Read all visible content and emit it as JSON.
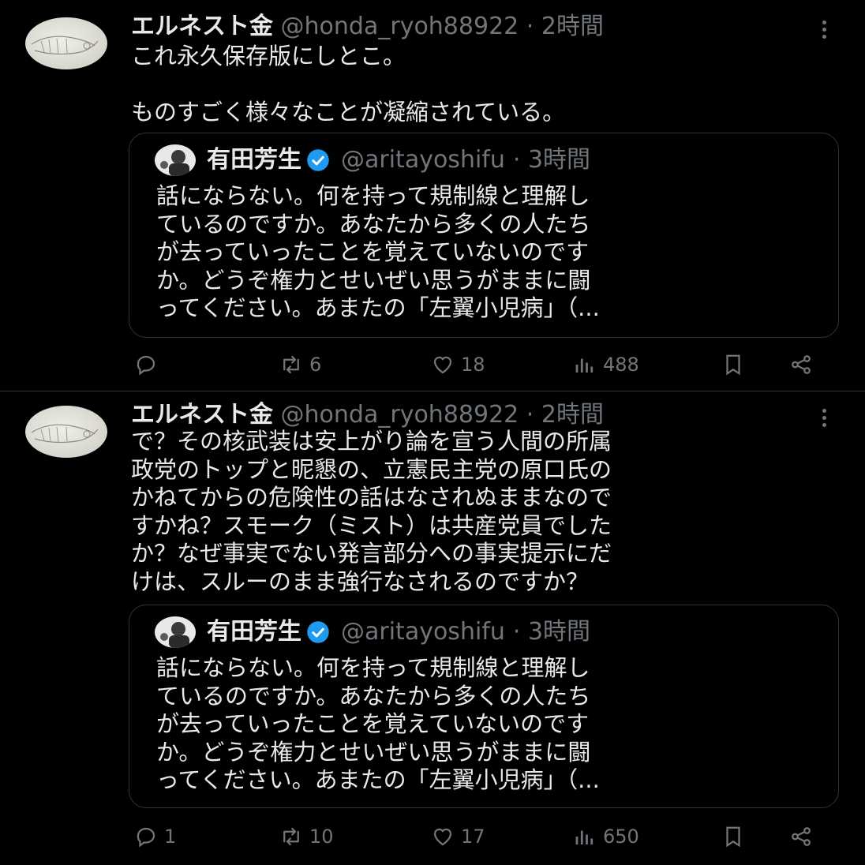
{
  "tweets": [
    {
      "author_name": "エルネスト金",
      "handle": "@honda_ryoh88922",
      "time": "· 2時間",
      "text": "これ永久保存版にしとこ。\n\nものすごく様々なことが凝縮されている。",
      "quote": {
        "author_name": "有田芳生",
        "handle": "@aritayoshifu",
        "time": "· 3時間",
        "text": "話にならない。何を持って規制線と理解し\nているのですか。あなたから多くの人たち\nが去っていったことを覚えていないのです\nか。どうぞ権力とせいぜい思うがままに闘\nってください。あまたの「左翼小児病」（..."
      },
      "actions": {
        "replies": "",
        "retweets": "6",
        "likes": "18",
        "views": "488"
      }
    },
    {
      "author_name": "エルネスト金",
      "handle": "@honda_ryoh88922",
      "time": "· 2時間",
      "text": "で？その核武装は安上がり論を宣う人間の所属\n政党のトップと昵懇の、立憲民主党の原口氏の\nかねてからの危険性の話はなされぬままなので\nすかね？スモーク（ミスト）は共産党員でした\nか？なぜ事実でない発言部分への事実提示にだ\nけは、スルーのまま強行なされるのですか？",
      "quote": {
        "author_name": "有田芳生",
        "handle": "@aritayoshifu",
        "time": "· 3時間",
        "text": "話にならない。何を持って規制線と理解し\nているのですか。あなたから多くの人たち\nが去っていったことを覚えていないのです\nか。どうぞ権力とせいぜい思うがままに闘\nってください。あまたの「左翼小児病」（..."
      },
      "actions": {
        "replies": "1",
        "retweets": "10",
        "likes": "17",
        "views": "650"
      }
    }
  ],
  "icons": {
    "reply": "reply-icon",
    "retweet": "retweet-icon",
    "like": "heart-icon",
    "views": "views-icon",
    "bookmark": "bookmark-icon",
    "share": "share-icon",
    "verified": "verified-badge-icon",
    "more": "more-icon"
  },
  "colors": {
    "background": "#000000",
    "text": "#e7e9ea",
    "muted": "#71767b",
    "verified": "#1d9bf0",
    "border": "#2f3336"
  }
}
